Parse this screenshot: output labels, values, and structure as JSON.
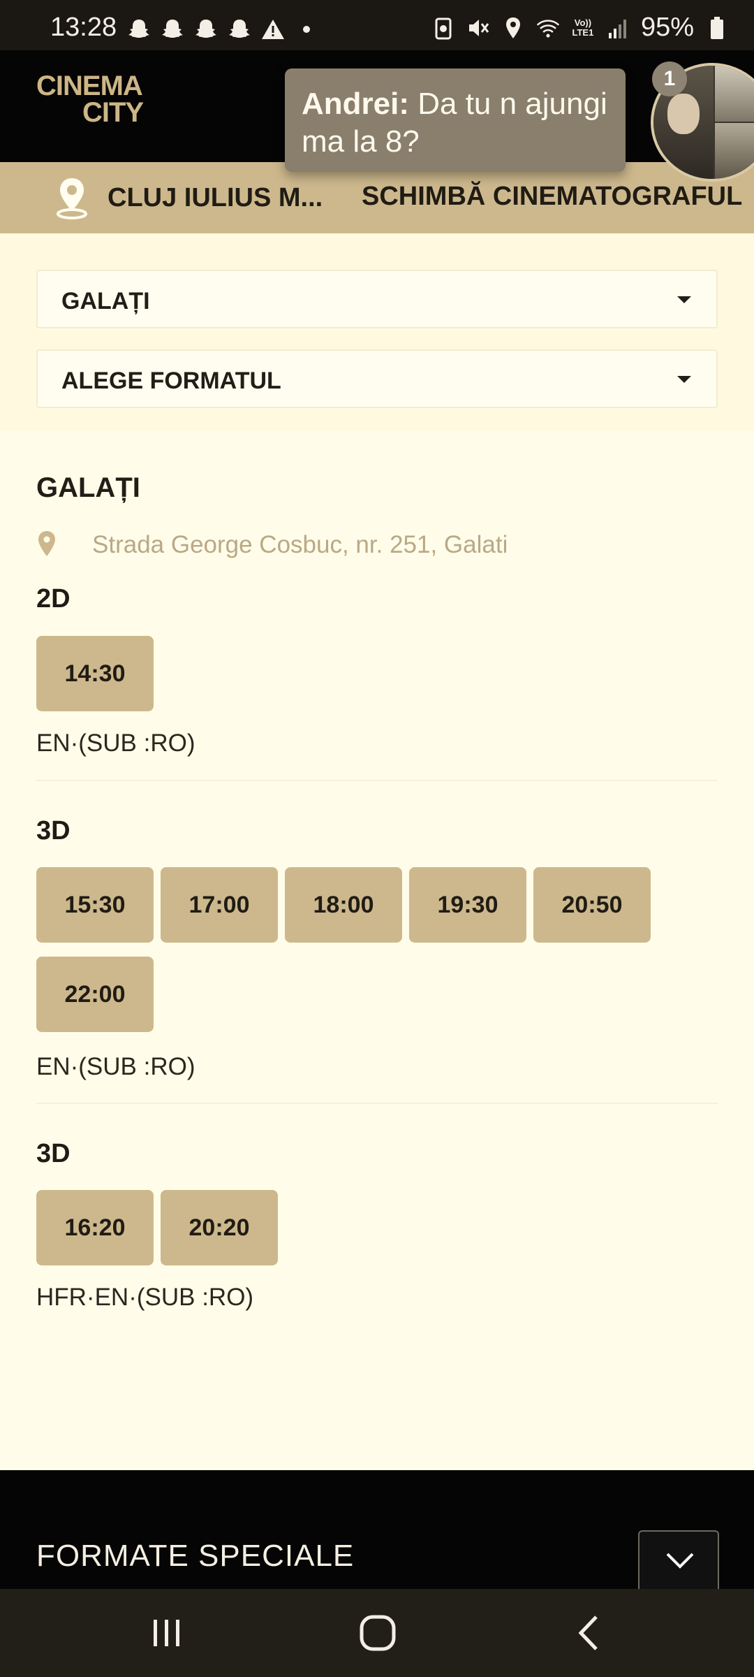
{
  "status_bar": {
    "time": "13:28",
    "battery": "95%",
    "left_icons": [
      "snapchat-icon",
      "snapchat-icon",
      "snapchat-icon",
      "snapchat-icon",
      "warning-icon",
      "dot"
    ],
    "right_icons": [
      "data-saver-icon",
      "mute-icon",
      "location-icon",
      "wifi-icon",
      "volte-icon",
      "signal-icon",
      "battery-icon"
    ],
    "volte_label": "Vo)) LTE1"
  },
  "header": {
    "logo_line1": "CINEMA",
    "logo_line2": "CITY"
  },
  "notification": {
    "sender": "Andrei:",
    "message": " Da tu n ajungi ma la 8?",
    "badge_count": "1"
  },
  "location_bar": {
    "cinema_name": "CLUJ IULIUS M...",
    "change_label": "SCHIMBĂ CINEMATOGRAFUL"
  },
  "filters": {
    "city_value": "GALAȚI",
    "format_value": "ALEGE FORMATUL"
  },
  "cinema": {
    "name": "GALAȚI",
    "address": "Strada George Cosbuc, nr. 251, Galati"
  },
  "showings": [
    {
      "format": "2D",
      "times": [
        "14:30"
      ],
      "language": "EN·(SUB :RO)"
    },
    {
      "format": "3D",
      "times": [
        "15:30",
        "17:00",
        "18:00",
        "19:30",
        "20:50",
        "22:00"
      ],
      "language": "EN·(SUB :RO)"
    },
    {
      "format": "3D",
      "times": [
        "16:20",
        "20:20"
      ],
      "language": "HFR·EN·(SUB :RO)"
    }
  ],
  "footer": {
    "title": "FORMATE SPECIALE"
  },
  "colors": {
    "accent": "#cdb88d",
    "background": "#fffde9",
    "header": "#050505"
  }
}
